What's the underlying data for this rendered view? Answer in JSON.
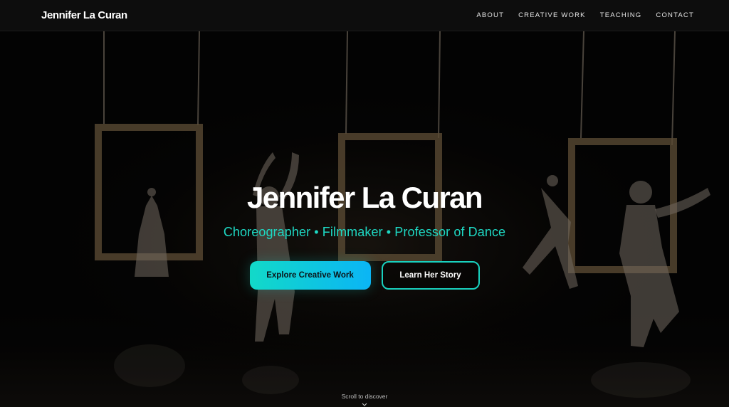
{
  "header": {
    "brand": "Jennifer La Curan",
    "nav": [
      {
        "label": "ABOUT"
      },
      {
        "label": "CREATIVE WORK"
      },
      {
        "label": "TEACHING"
      },
      {
        "label": "CONTACT"
      }
    ]
  },
  "hero": {
    "title": "Jennifer La Curan",
    "subtitle": "Choreographer • Filmmaker • Professor of Dance",
    "primary_button": "Explore Creative Work",
    "secondary_button": "Learn Her Story",
    "scroll_hint": "Scroll to discover"
  },
  "colors": {
    "accent": "#1ed9c4",
    "gradient_start": "#12d9c8",
    "gradient_end": "#0bb5f5",
    "nav_bg": "#0d0d0d"
  },
  "icons": {
    "scroll": "chevron-down-icon"
  }
}
